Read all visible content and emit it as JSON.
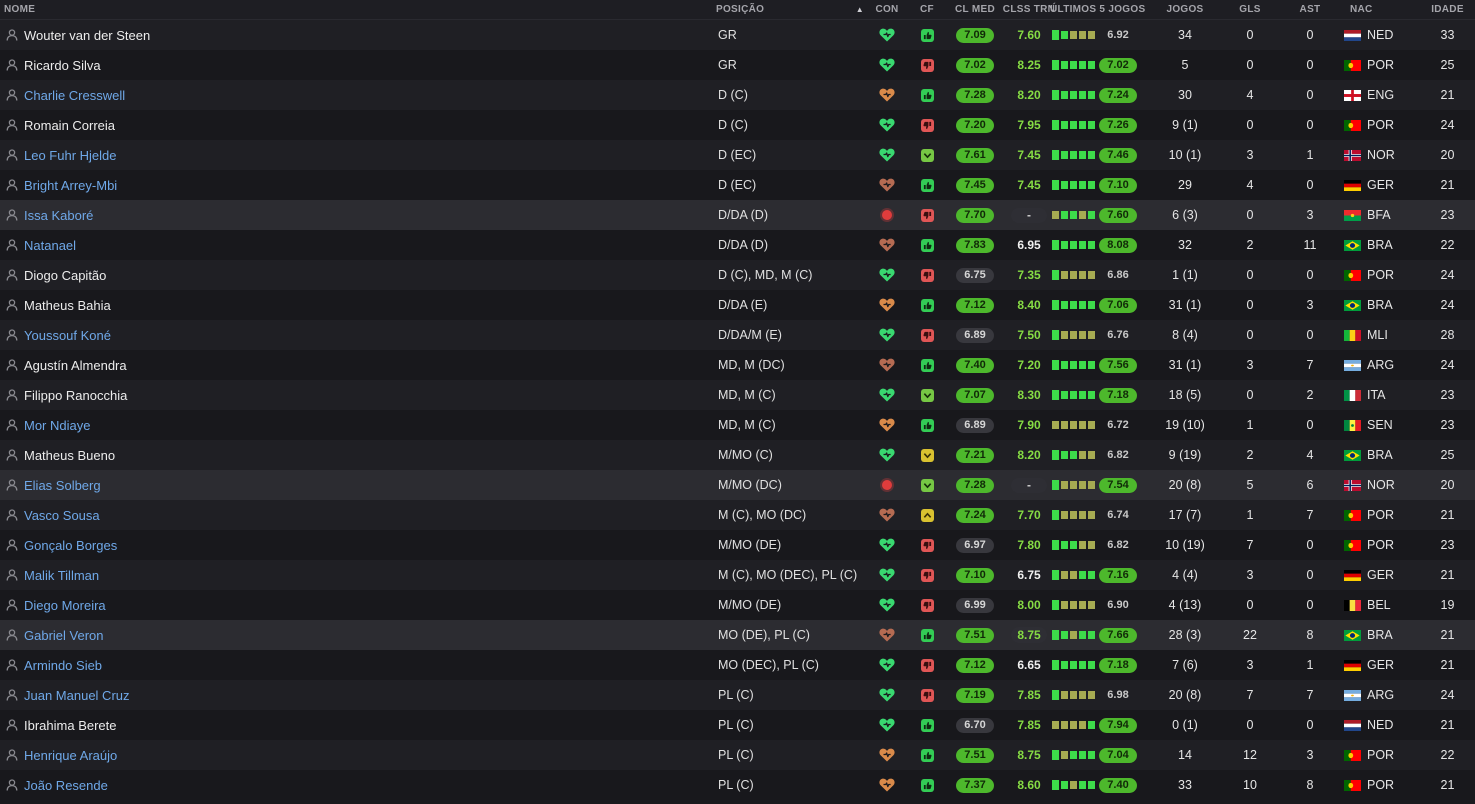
{
  "columns": {
    "name": "NOME",
    "position": "POSIÇÃO",
    "con": "CON",
    "cf": "CF",
    "avg": "CL MED",
    "cls": "CLSS TRN",
    "last5": "ÚLTIMOS 5 JOGOS",
    "apps": "JOGOS",
    "gls": "GLS",
    "ast": "AST",
    "nat": "NAC",
    "age": "IDADE"
  },
  "colors": {
    "link": "#6fa8e8",
    "heart_green": "#39d870",
    "heart_orange": "#d98a4a",
    "heart_brown": "#b56b52",
    "pill_green": "#4db82c"
  },
  "players": [
    {
      "name": "Wouter van der Steen",
      "link": false,
      "pos": "GR",
      "con": "green",
      "cf": "up-green",
      "avg": "7.09",
      "avg_style": "green",
      "cls": "7.60",
      "cls_style": "green",
      "bars": "ggyyy",
      "last": "6.92",
      "last_style": "plain",
      "apps": "34",
      "gls": "0",
      "ast": "0",
      "nat": "NED",
      "flag": "ned",
      "age": "33"
    },
    {
      "name": "Ricardo Silva",
      "link": false,
      "pos": "GR",
      "con": "green",
      "cf": "down-red",
      "avg": "7.02",
      "avg_style": "green",
      "cls": "8.25",
      "cls_style": "green",
      "bars": "ggggg",
      "last": "7.02",
      "last_style": "green",
      "apps": "5",
      "gls": "0",
      "ast": "0",
      "nat": "POR",
      "flag": "por",
      "age": "25"
    },
    {
      "name": "Charlie Cresswell",
      "link": true,
      "pos": "D (C)",
      "con": "orange",
      "cf": "up-green",
      "avg": "7.28",
      "avg_style": "green",
      "cls": "8.20",
      "cls_style": "green",
      "bars": "ggggg",
      "last": "7.24",
      "last_style": "green",
      "apps": "30",
      "gls": "4",
      "ast": "0",
      "nat": "ENG",
      "flag": "eng",
      "age": "21"
    },
    {
      "name": "Romain Correia",
      "link": false,
      "pos": "D (C)",
      "con": "green",
      "cf": "down-red",
      "avg": "7.20",
      "avg_style": "green",
      "cls": "7.95",
      "cls_style": "green",
      "bars": "ggggg",
      "last": "7.26",
      "last_style": "green",
      "apps": "9 (1)",
      "gls": "0",
      "ast": "0",
      "nat": "POR",
      "flag": "por",
      "age": "24"
    },
    {
      "name": "Leo Fuhr Hjelde",
      "link": true,
      "pos": "D (EC)",
      "con": "green",
      "cf": "chev-green",
      "avg": "7.61",
      "avg_style": "green",
      "cls": "7.45",
      "cls_style": "green",
      "bars": "ggggg",
      "last": "7.46",
      "last_style": "green",
      "apps": "10 (1)",
      "gls": "3",
      "ast": "1",
      "nat": "NOR",
      "flag": "nor",
      "age": "20"
    },
    {
      "name": "Bright Arrey-Mbi",
      "link": true,
      "pos": "D (EC)",
      "con": "brown",
      "cf": "up-green",
      "avg": "7.45",
      "avg_style": "green",
      "cls": "7.45",
      "cls_style": "green",
      "bars": "ggggg",
      "last": "7.10",
      "last_style": "green",
      "apps": "29",
      "gls": "4",
      "ast": "0",
      "nat": "GER",
      "flag": "ger",
      "age": "21"
    },
    {
      "name": "Issa Kaboré",
      "link": true,
      "pos": "D/DA (D)",
      "con": "injury",
      "cf": "down-red",
      "avg": "7.70",
      "avg_style": "green",
      "cls": "-",
      "cls_style": "dash",
      "bars": "yggyg",
      "last": "7.60",
      "last_style": "green",
      "apps": "6 (3)",
      "gls": "0",
      "ast": "3",
      "nat": "BFA",
      "flag": "bfa",
      "age": "23",
      "hl": true
    },
    {
      "name": "Natanael",
      "link": true,
      "pos": "D/DA (D)",
      "con": "brown",
      "cf": "up-green",
      "avg": "7.83",
      "avg_style": "green",
      "cls": "6.95",
      "cls_style": "white",
      "bars": "ggggg",
      "last": "8.08",
      "last_style": "green",
      "apps": "32",
      "gls": "2",
      "ast": "11",
      "nat": "BRA",
      "flag": "bra",
      "age": "22"
    },
    {
      "name": "Diogo Capitão",
      "link": false,
      "pos": "D (C), MD, M (C)",
      "con": "green",
      "cf": "down-red",
      "avg": "6.75",
      "avg_style": "plain",
      "cls": "7.35",
      "cls_style": "green",
      "bars": "gyyyy",
      "last": "6.86",
      "last_style": "plain",
      "apps": "1 (1)",
      "gls": "0",
      "ast": "0",
      "nat": "POR",
      "flag": "por",
      "age": "24"
    },
    {
      "name": "Matheus Bahia",
      "link": false,
      "pos": "D/DA (E)",
      "con": "orange",
      "cf": "up-green",
      "avg": "7.12",
      "avg_style": "green",
      "cls": "8.40",
      "cls_style": "green",
      "bars": "ggggg",
      "last": "7.06",
      "last_style": "green",
      "apps": "31 (1)",
      "gls": "0",
      "ast": "3",
      "nat": "BRA",
      "flag": "bra",
      "age": "24"
    },
    {
      "name": "Youssouf Koné",
      "link": true,
      "pos": "D/DA/M (E)",
      "con": "green",
      "cf": "down-red",
      "avg": "6.89",
      "avg_style": "plain",
      "cls": "7.50",
      "cls_style": "green",
      "bars": "gyyyy",
      "last": "6.76",
      "last_style": "plain",
      "apps": "8 (4)",
      "gls": "0",
      "ast": "0",
      "nat": "MLI",
      "flag": "mli",
      "age": "28"
    },
    {
      "name": "Agustín Almendra",
      "link": false,
      "pos": "MD, M (DC)",
      "con": "brown",
      "cf": "up-green",
      "avg": "7.40",
      "avg_style": "green",
      "cls": "7.20",
      "cls_style": "green",
      "bars": "ggggg",
      "last": "7.56",
      "last_style": "green",
      "apps": "31 (1)",
      "gls": "3",
      "ast": "7",
      "nat": "ARG",
      "flag": "arg",
      "age": "24"
    },
    {
      "name": "Filippo Ranocchia",
      "link": false,
      "pos": "MD, M (C)",
      "con": "green",
      "cf": "chev-green",
      "avg": "7.07",
      "avg_style": "green",
      "cls": "8.30",
      "cls_style": "green",
      "bars": "ggggg",
      "last": "7.18",
      "last_style": "green",
      "apps": "18 (5)",
      "gls": "0",
      "ast": "2",
      "nat": "ITA",
      "flag": "ita",
      "age": "23"
    },
    {
      "name": "Mor Ndiaye",
      "link": true,
      "pos": "MD, M (C)",
      "con": "orange",
      "cf": "up-green",
      "avg": "6.89",
      "avg_style": "plain",
      "cls": "7.90",
      "cls_style": "green",
      "bars": "yyyyy",
      "last": "6.72",
      "last_style": "plain",
      "apps": "19 (10)",
      "gls": "1",
      "ast": "0",
      "nat": "SEN",
      "flag": "sen",
      "age": "23"
    },
    {
      "name": "Matheus Bueno",
      "link": false,
      "pos": "M/MO (C)",
      "con": "green",
      "cf": "chev-yellow",
      "avg": "7.21",
      "avg_style": "green",
      "cls": "8.20",
      "cls_style": "green",
      "bars": "gggyy",
      "last": "6.82",
      "last_style": "plain",
      "apps": "9 (19)",
      "gls": "2",
      "ast": "4",
      "nat": "BRA",
      "flag": "bra",
      "age": "25"
    },
    {
      "name": "Elias Solberg",
      "link": true,
      "pos": "M/MO (DC)",
      "con": "injury",
      "cf": "chev-green",
      "avg": "7.28",
      "avg_style": "green",
      "cls": "-",
      "cls_style": "dash",
      "bars": "gyyyy",
      "last": "7.54",
      "last_style": "green",
      "apps": "20 (8)",
      "gls": "5",
      "ast": "6",
      "nat": "NOR",
      "flag": "nor",
      "age": "20",
      "hl": true
    },
    {
      "name": "Vasco Sousa",
      "link": true,
      "pos": "M (C), MO (DC)",
      "con": "brown",
      "cf": "chev-up-yellow",
      "avg": "7.24",
      "avg_style": "green",
      "cls": "7.70",
      "cls_style": "green",
      "bars": "gyyyy",
      "last": "6.74",
      "last_style": "plain",
      "apps": "17 (7)",
      "gls": "1",
      "ast": "7",
      "nat": "POR",
      "flag": "por",
      "age": "21"
    },
    {
      "name": "Gonçalo Borges",
      "link": true,
      "pos": "M/MO (DE)",
      "con": "green",
      "cf": "down-red",
      "avg": "6.97",
      "avg_style": "plain",
      "cls": "7.80",
      "cls_style": "green",
      "bars": "gggyy",
      "last": "6.82",
      "last_style": "plain",
      "apps": "10 (19)",
      "gls": "7",
      "ast": "0",
      "nat": "POR",
      "flag": "por",
      "age": "23"
    },
    {
      "name": "Malik Tillman",
      "link": true,
      "pos": "M (C), MO (DEC), PL (C)",
      "con": "green",
      "cf": "down-red",
      "avg": "7.10",
      "avg_style": "green",
      "cls": "6.75",
      "cls_style": "white",
      "bars": "gyygg",
      "last": "7.16",
      "last_style": "green",
      "apps": "4 (4)",
      "gls": "3",
      "ast": "0",
      "nat": "GER",
      "flag": "ger",
      "age": "21"
    },
    {
      "name": "Diego Moreira",
      "link": true,
      "pos": "M/MO (DE)",
      "con": "green",
      "cf": "down-red",
      "avg": "6.99",
      "avg_style": "plain",
      "cls": "8.00",
      "cls_style": "green",
      "bars": "gyyyy",
      "last": "6.90",
      "last_style": "plain",
      "apps": "4 (13)",
      "gls": "0",
      "ast": "0",
      "nat": "BEL",
      "flag": "bel",
      "age": "19"
    },
    {
      "name": "Gabriel Veron",
      "link": true,
      "pos": "MO (DE), PL (C)",
      "con": "brown",
      "cf": "up-green",
      "avg": "7.51",
      "avg_style": "green",
      "cls": "8.75",
      "cls_style": "green-dark",
      "bars": "ggygg",
      "last": "7.66",
      "last_style": "green",
      "apps": "28 (3)",
      "gls": "22",
      "ast": "8",
      "nat": "BRA",
      "flag": "bra",
      "age": "21",
      "hl": true
    },
    {
      "name": "Armindo Sieb",
      "link": true,
      "pos": "MO (DEC), PL (C)",
      "con": "green",
      "cf": "down-red",
      "avg": "7.12",
      "avg_style": "green",
      "cls": "6.65",
      "cls_style": "white",
      "bars": "ggggg",
      "last": "7.18",
      "last_style": "green",
      "apps": "7 (6)",
      "gls": "3",
      "ast": "1",
      "nat": "GER",
      "flag": "ger",
      "age": "21"
    },
    {
      "name": "Juan Manuel Cruz",
      "link": true,
      "pos": "PL (C)",
      "con": "green",
      "cf": "down-red",
      "avg": "7.19",
      "avg_style": "green",
      "cls": "7.85",
      "cls_style": "green",
      "bars": "gyyyy",
      "last": "6.98",
      "last_style": "plain",
      "apps": "20 (8)",
      "gls": "7",
      "ast": "7",
      "nat": "ARG",
      "flag": "arg",
      "age": "24"
    },
    {
      "name": "Ibrahima Berete",
      "link": false,
      "pos": "PL (C)",
      "con": "green",
      "cf": "up-green",
      "avg": "6.70",
      "avg_style": "plain",
      "cls": "7.85",
      "cls_style": "green",
      "bars": "yyyyg",
      "last": "7.94",
      "last_style": "green",
      "apps": "0 (1)",
      "gls": "0",
      "ast": "0",
      "nat": "NED",
      "flag": "ned",
      "age": "21"
    },
    {
      "name": "Henrique Araújo",
      "link": true,
      "pos": "PL (C)",
      "con": "orange",
      "cf": "up-green",
      "avg": "7.51",
      "avg_style": "green",
      "cls": "8.75",
      "cls_style": "green",
      "bars": "gyggg",
      "last": "7.04",
      "last_style": "green",
      "apps": "14",
      "gls": "12",
      "ast": "3",
      "nat": "POR",
      "flag": "por",
      "age": "22"
    },
    {
      "name": "João Resende",
      "link": true,
      "pos": "PL (C)",
      "con": "orange",
      "cf": "up-green",
      "avg": "7.37",
      "avg_style": "green",
      "cls": "8.60",
      "cls_style": "green",
      "bars": "ggygg",
      "last": "7.40",
      "last_style": "green",
      "apps": "33",
      "gls": "10",
      "ast": "8",
      "nat": "POR",
      "flag": "por",
      "age": "21"
    }
  ]
}
